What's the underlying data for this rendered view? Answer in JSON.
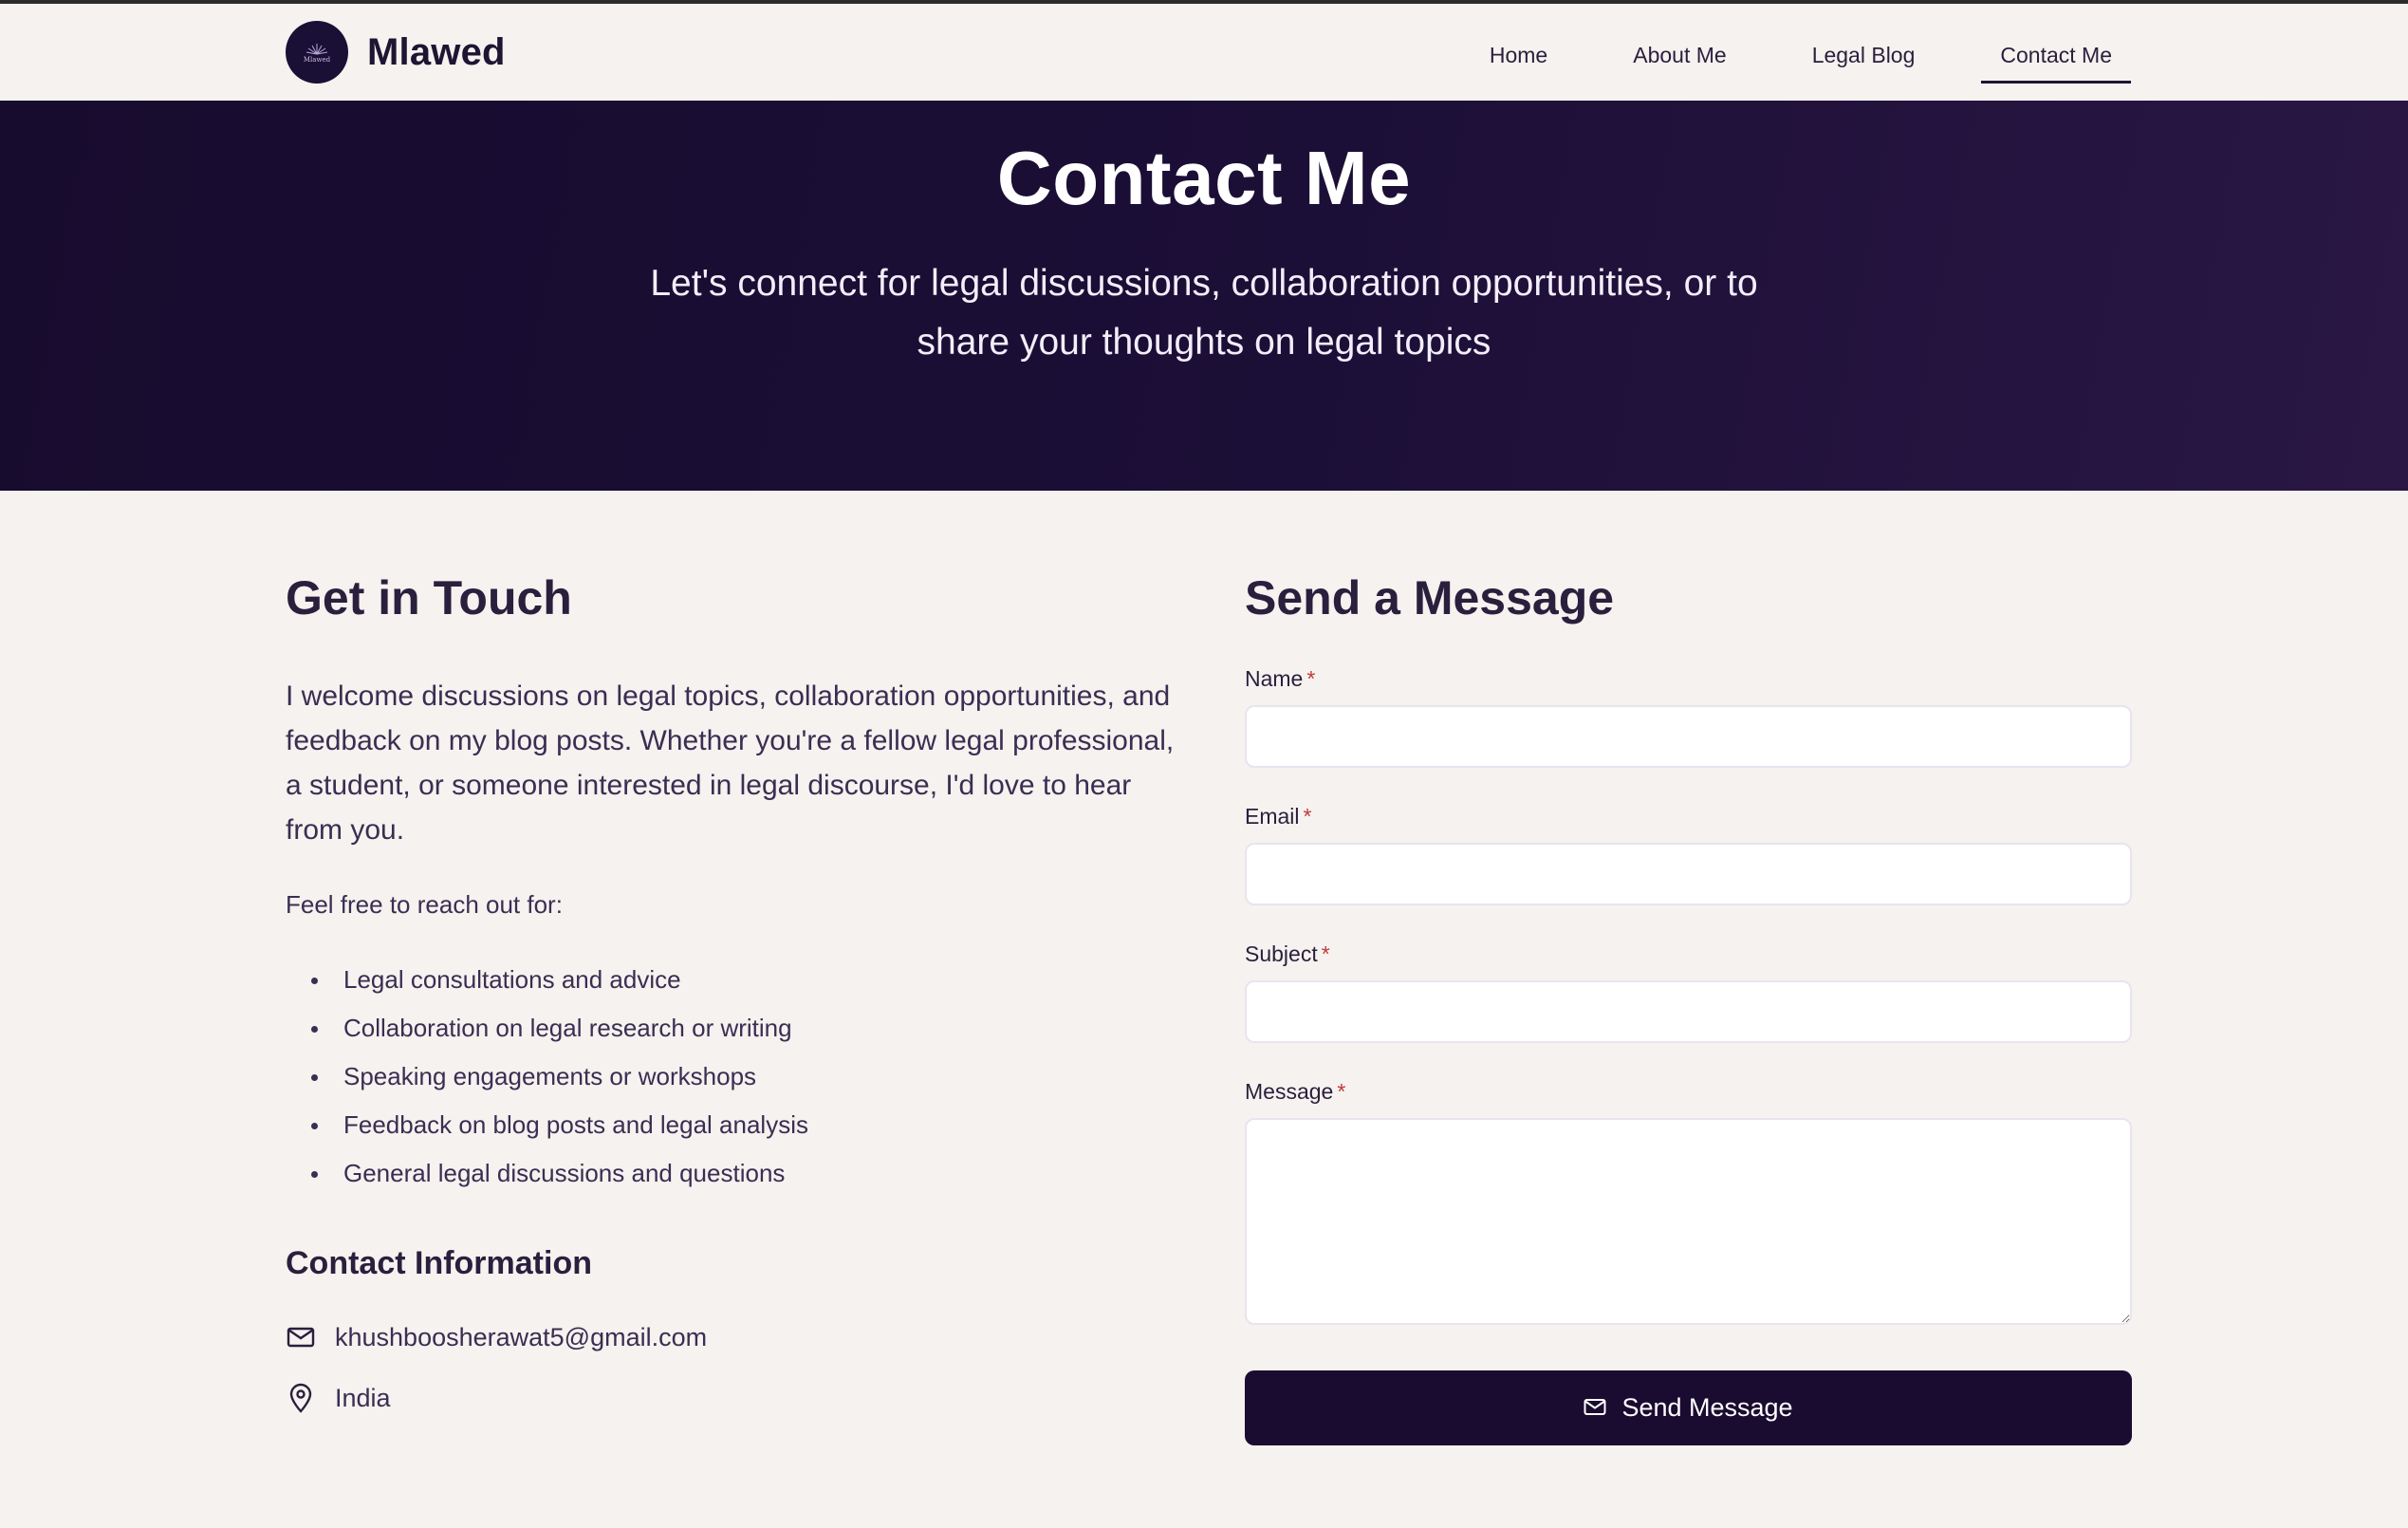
{
  "brand": {
    "name": "Mlawed",
    "logo_text": "Mlawed"
  },
  "nav": {
    "items": [
      {
        "label": "Home",
        "active": false
      },
      {
        "label": "About Me",
        "active": false
      },
      {
        "label": "Legal Blog",
        "active": false
      },
      {
        "label": "Contact Me",
        "active": true
      }
    ]
  },
  "hero": {
    "title": "Contact Me",
    "subtitle": "Let's connect for legal discussions, collaboration opportunities, or to share your thoughts on legal topics"
  },
  "get_in_touch": {
    "heading": "Get in Touch",
    "intro": "I welcome discussions on legal topics, collaboration opportunities, and feedback on my blog posts. Whether you're a fellow legal professional, a student, or someone interested in legal discourse, I'd love to hear from you.",
    "reach_label": "Feel free to reach out for:",
    "reasons": [
      "Legal consultations and advice",
      "Collaboration on legal research or writing",
      "Speaking engagements or workshops",
      "Feedback on blog posts and legal analysis",
      "General legal discussions and questions"
    ]
  },
  "contact_info": {
    "heading": "Contact Information",
    "email": "khushboosherawat5@gmail.com",
    "location": "India",
    "email_icon": "mail-icon",
    "location_icon": "map-pin-icon"
  },
  "form": {
    "heading": "Send a Message",
    "required_mark": "*",
    "fields": {
      "name": {
        "label": "Name",
        "value": ""
      },
      "email": {
        "label": "Email",
        "value": ""
      },
      "subject": {
        "label": "Subject",
        "value": ""
      },
      "message": {
        "label": "Message",
        "value": ""
      }
    },
    "submit_label": "Send Message",
    "submit_icon": "mail-icon"
  },
  "colors": {
    "hero_bg": "#1c0f37",
    "button_bg": "#1a0b30",
    "page_bg": "#f5f2ef",
    "required": "#c03a3a"
  }
}
